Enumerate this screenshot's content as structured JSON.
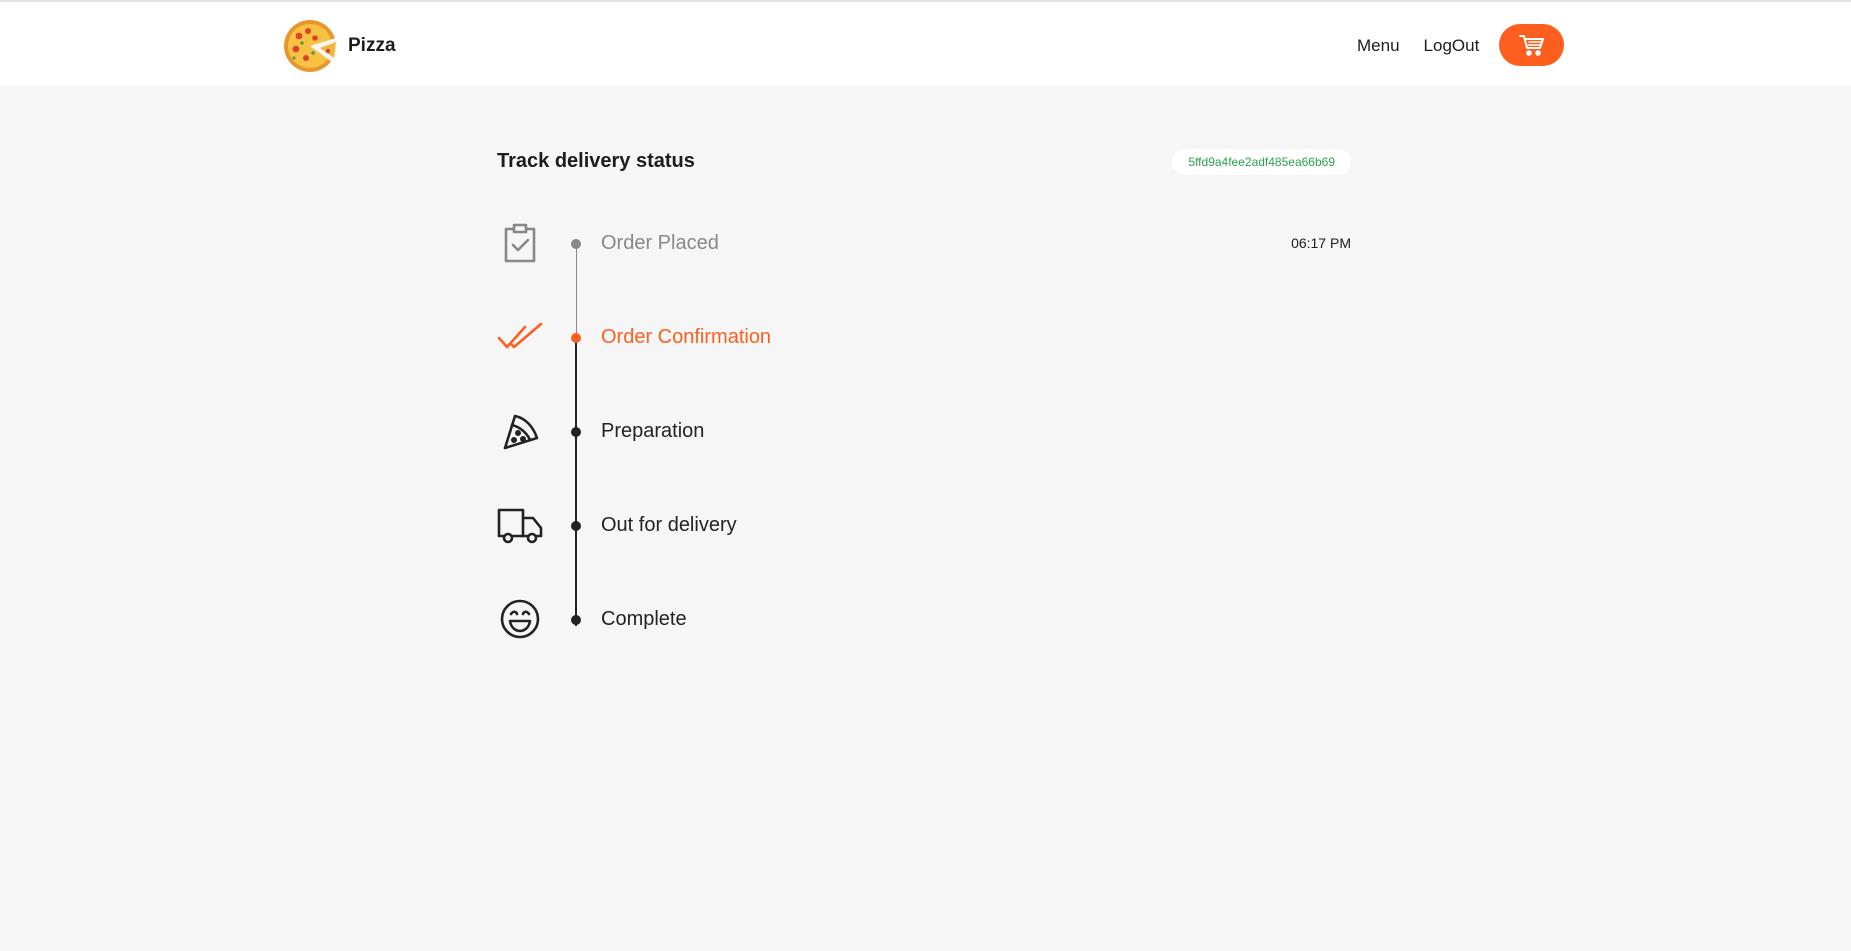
{
  "brand": {
    "name": "Pizza",
    "logo": "pizza-logo"
  },
  "nav": {
    "menu_label": "Menu",
    "logout_label": "LogOut",
    "cart_icon": "cart-icon"
  },
  "page": {
    "title": "Track delivery status",
    "order_id": "5ffd9a4fee2adf485ea66b69"
  },
  "timeline": {
    "steps": [
      {
        "label": "Order Placed",
        "time": "06:17 PM",
        "status": "done",
        "icon": "clipboard-check-icon"
      },
      {
        "label": "Order Confirmation",
        "time": "",
        "status": "current",
        "icon": "double-check-icon"
      },
      {
        "label": "Preparation",
        "time": "",
        "status": "pending",
        "icon": "pizza-slice-icon"
      },
      {
        "label": "Out for delivery",
        "time": "",
        "status": "pending",
        "icon": "truck-icon"
      },
      {
        "label": "Complete",
        "time": "",
        "status": "pending",
        "icon": "smile-icon"
      }
    ]
  },
  "colors": {
    "accent": "#fe5f1e",
    "done": "#888888",
    "pending": "#232323",
    "order_id_text": "#2aa24a"
  }
}
